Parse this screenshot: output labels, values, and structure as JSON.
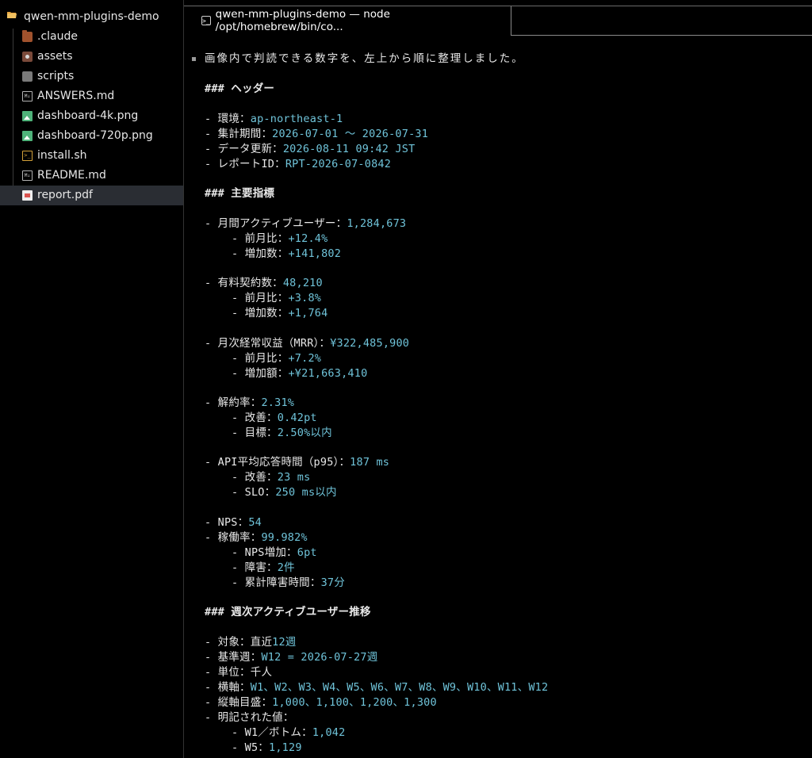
{
  "sidebar": {
    "root": "qwen-mm-plugins-demo",
    "items": [
      {
        "label": ".claude",
        "icon": "folder-icon"
      },
      {
        "label": "assets",
        "icon": "image-folder-icon"
      },
      {
        "label": "scripts",
        "icon": "folder-icon"
      },
      {
        "label": "ANSWERS.md",
        "icon": "markdown-icon"
      },
      {
        "label": "dashboard-4k.png",
        "icon": "image-icon"
      },
      {
        "label": "dashboard-720p.png",
        "icon": "image-icon"
      },
      {
        "label": "install.sh",
        "icon": "shell-icon"
      },
      {
        "label": "README.md",
        "icon": "markdown-icon"
      },
      {
        "label": "report.pdf",
        "icon": "pdf-icon"
      }
    ],
    "selected": "report.pdf"
  },
  "tab": {
    "title": "qwen-mm-plugins-demo — node /opt/homebrew/bin/co...",
    "icon_glyph": ">_"
  },
  "terminal": {
    "intro": "画像内で判読できる数字を、左上から順に整理しました。",
    "lines": [
      {
        "k": "### ヘッダー",
        "v": "",
        "hdr": true
      },
      {
        "k": "- 環境：",
        "v": "ap-northeast-1"
      },
      {
        "k": "- 集計期間：",
        "v": "2026-07-01 〜 2026-07-31"
      },
      {
        "k": "- データ更新：",
        "v": "2026-08-11 09:42 JST"
      },
      {
        "k": "- レポートID：",
        "v": "RPT-2026-07-0842"
      },
      {
        "k": "### 主要指標",
        "v": "",
        "hdr": true
      },
      {
        "k": "- 月間アクティブユーザー：",
        "v": "1,284,673"
      },
      {
        "k": "- 前月比：",
        "v": "+12.4%"
      },
      {
        "k": "- 増加数：",
        "v": "+141,802"
      },
      {
        "k": "- 有料契約数：",
        "v": "48,210"
      },
      {
        "k": "- 前月比：",
        "v": "+3.8%"
      },
      {
        "k": "- 増加数：",
        "v": "+1,764"
      },
      {
        "k": "- 月次経常収益（MRR）：",
        "v": "¥322,485,900"
      },
      {
        "k": "- 前月比：",
        "v": "+7.2%"
      },
      {
        "k": "- 増加額：",
        "v": "+¥21,663,410"
      },
      {
        "k": "- 解約率：",
        "v": "2.31%"
      },
      {
        "k": "- 改善：",
        "v": "0.42pt"
      },
      {
        "k": "- 目標：",
        "v": "2.50%以内"
      },
      {
        "k": "- API平均応答時間（p95）：",
        "v": "187 ms"
      },
      {
        "k": "- 改善：",
        "v": "23 ms"
      },
      {
        "k": "- SLO：",
        "v": "250 ms以内"
      },
      {
        "k": "- NPS：",
        "v": "54"
      },
      {
        "k": "- 稼働率：",
        "v": "99.982%"
      },
      {
        "k": "- NPS増加：",
        "v": "6pt"
      },
      {
        "k": "- 障害：",
        "v": "2件"
      },
      {
        "k": "- 累計障害時間：",
        "v": "37分"
      },
      {
        "k": "### 週次アクティブユーザー推移",
        "v": "",
        "hdr": true
      },
      {
        "k": "- 対象：直近",
        "v": "12週"
      },
      {
        "k": "- 基準週：",
        "v": "W12 = 2026-07-27週"
      },
      {
        "k": "- 単位：千人",
        "v": ""
      },
      {
        "k": "- 横軸：",
        "v": "W1、W2、W3、W4、W5、W6、W7、W8、W9、W10、W11、W12"
      },
      {
        "k": "- 縦軸目盛：",
        "v": "1,000、1,100、1,200、1,300"
      },
      {
        "k": "- 明記された値：",
        "v": ""
      },
      {
        "k": "- W1／ボトム：",
        "v": "1,042"
      },
      {
        "k": "- W5：",
        "v": "1,129"
      }
    ]
  },
  "colors": {
    "value": "#6fc3d9",
    "background": "#000000",
    "text": "#e8e8e8"
  }
}
